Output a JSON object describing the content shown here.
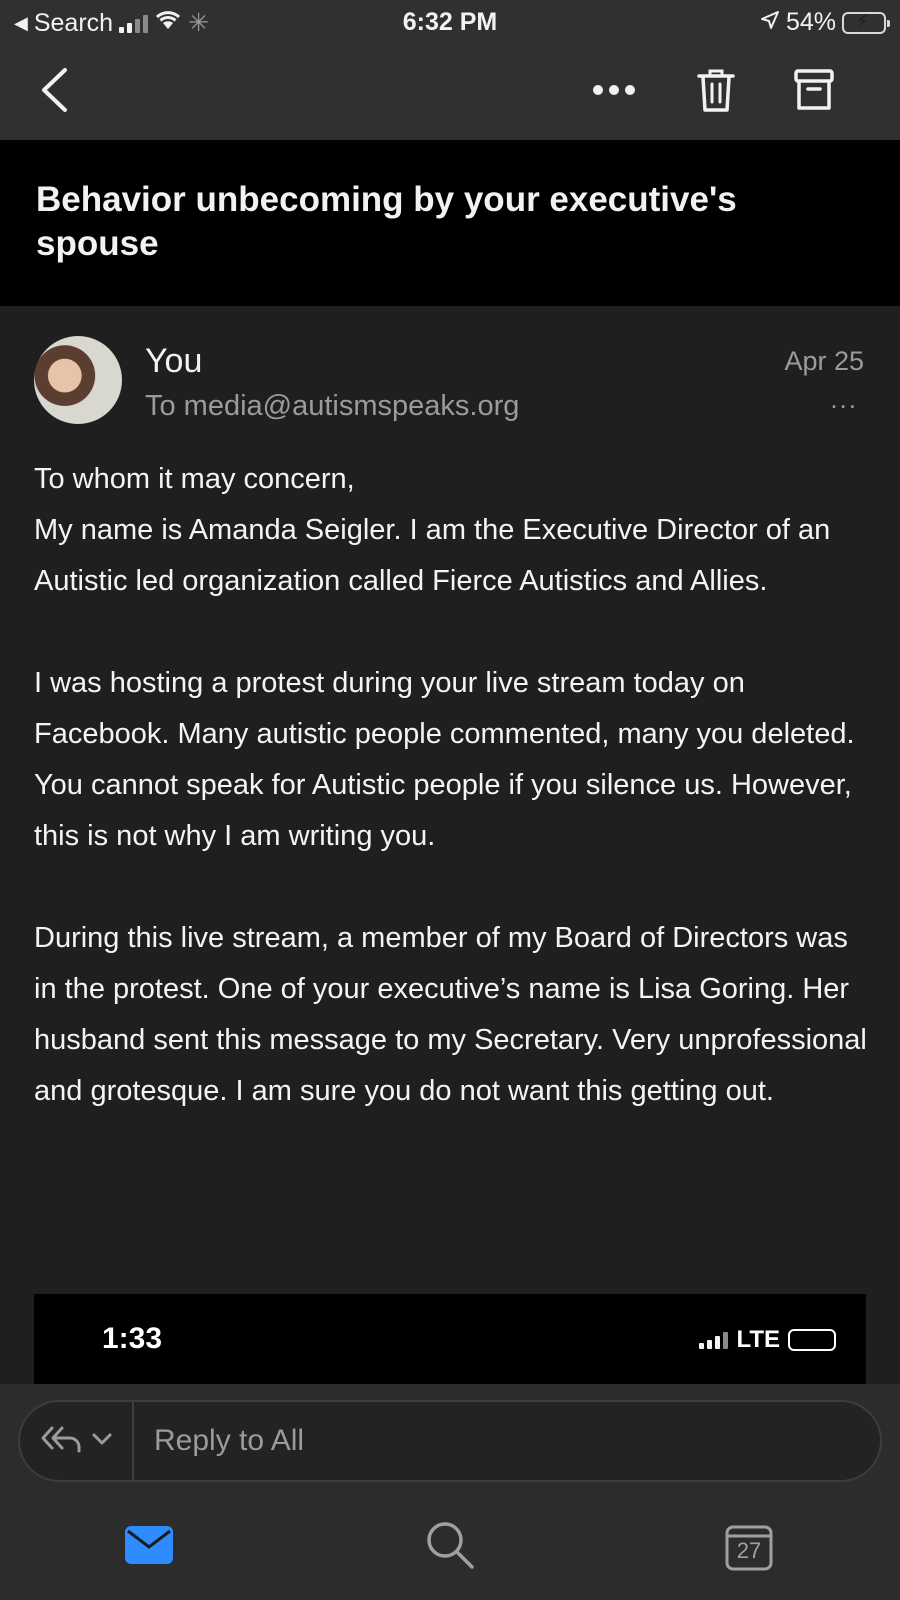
{
  "status_bar": {
    "back_app": "Search",
    "time": "6:32 PM",
    "battery": "54%",
    "battery_level": 0.54
  },
  "toolbar": {
    "back_icon": "chevron-left-icon",
    "more_icon": "more-horizontal-icon",
    "delete_icon": "trash-icon",
    "archive_icon": "archive-icon"
  },
  "email": {
    "subject": "Behavior unbecoming by your executive's spouse",
    "sender": "You",
    "recipient": "To media@autismspeaks.org",
    "date": "Apr 25",
    "more_label": "...",
    "paragraphs": [
      "To whom it may concern,",
      "My name is Amanda Seigler. I am the Executive Director of an Autistic led organization called Fierce Autistics and Allies.",
      "I was hosting a protest during your live stream today on Facebook. Many autistic people commented, many you deleted. You cannot speak for Autistic people if you silence us. However, this is not why I am writing you.",
      "During this live stream, a member of my Board of Directors was in the protest. One of your executive’s name is Lisa Goring. Her husband sent this message to my Secretary. Very unprofessional and grotesque. I am sure you do not want this getting out."
    ],
    "embedded_screenshot": {
      "time": "1:33",
      "network": "LTE"
    }
  },
  "reply": {
    "label": "Reply to All",
    "icon": "reply-all-icon"
  },
  "tabbar": {
    "mail_icon": "mail-icon",
    "search_icon": "search-icon",
    "calendar_icon": "calendar-icon",
    "calendar_day": "27",
    "accent_color": "#2f8cff"
  }
}
